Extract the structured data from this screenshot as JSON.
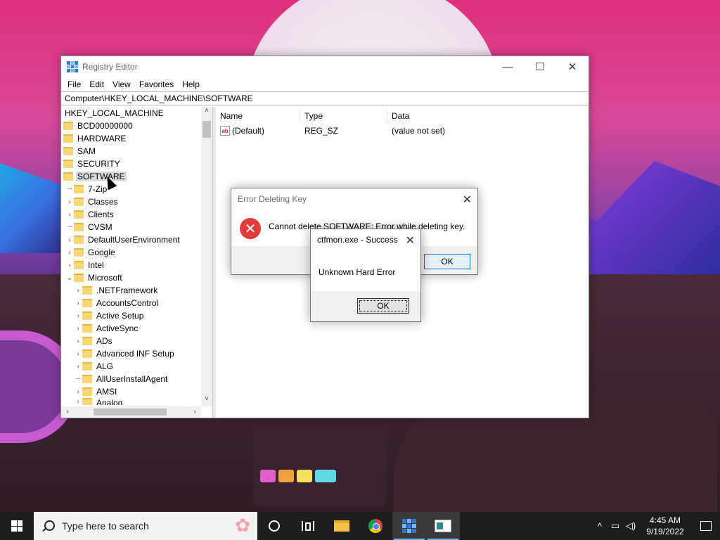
{
  "window": {
    "title": "Registry Editor",
    "controls": {
      "minimize": "—",
      "maximize": "☐",
      "close": "✕"
    },
    "menu": [
      "File",
      "Edit",
      "View",
      "Favorites",
      "Help"
    ],
    "address": "Computer\\HKEY_LOCAL_MACHINE\\SOFTWARE"
  },
  "tree": {
    "root": "HKEY_LOCAL_MACHINE",
    "level1": [
      "BCD00000000",
      "HARDWARE",
      "SAM",
      "SECURITY",
      "SOFTWARE"
    ],
    "software_children": [
      "7-Zip",
      "Classes",
      "Clients",
      "CVSM",
      "DefaultUserEnvironment",
      "Google",
      "Intel",
      "Microsoft"
    ],
    "microsoft_children": [
      ".NETFramework",
      "AccountsControl",
      "Active Setup",
      "ActiveSync",
      "ADs",
      "Advanced INF Setup",
      "ALG",
      "AllUserInstallAgent",
      "AMSI",
      "Analog"
    ],
    "selected": "SOFTWARE"
  },
  "values_pane": {
    "headers": {
      "name": "Name",
      "type": "Type",
      "data": "Data"
    },
    "rows": [
      {
        "name": "(Default)",
        "type": "REG_SZ",
        "data": "(value not set)",
        "icon": "ab"
      }
    ]
  },
  "error_dialog": {
    "title": "Error Deleting Key",
    "message": "Cannot delete SOFTWARE:  Error while deleting key.",
    "ok": "OK",
    "close": "✕"
  },
  "ctf_dialog": {
    "title": "ctfmon.exe - Success",
    "message": "Unknown Hard Error",
    "ok": "OK",
    "close": "✕"
  },
  "taskbar": {
    "search_placeholder": "Type here to search",
    "clock_time": "4:45 AM",
    "clock_date": "9/19/2022",
    "tray_chevron": "^"
  }
}
